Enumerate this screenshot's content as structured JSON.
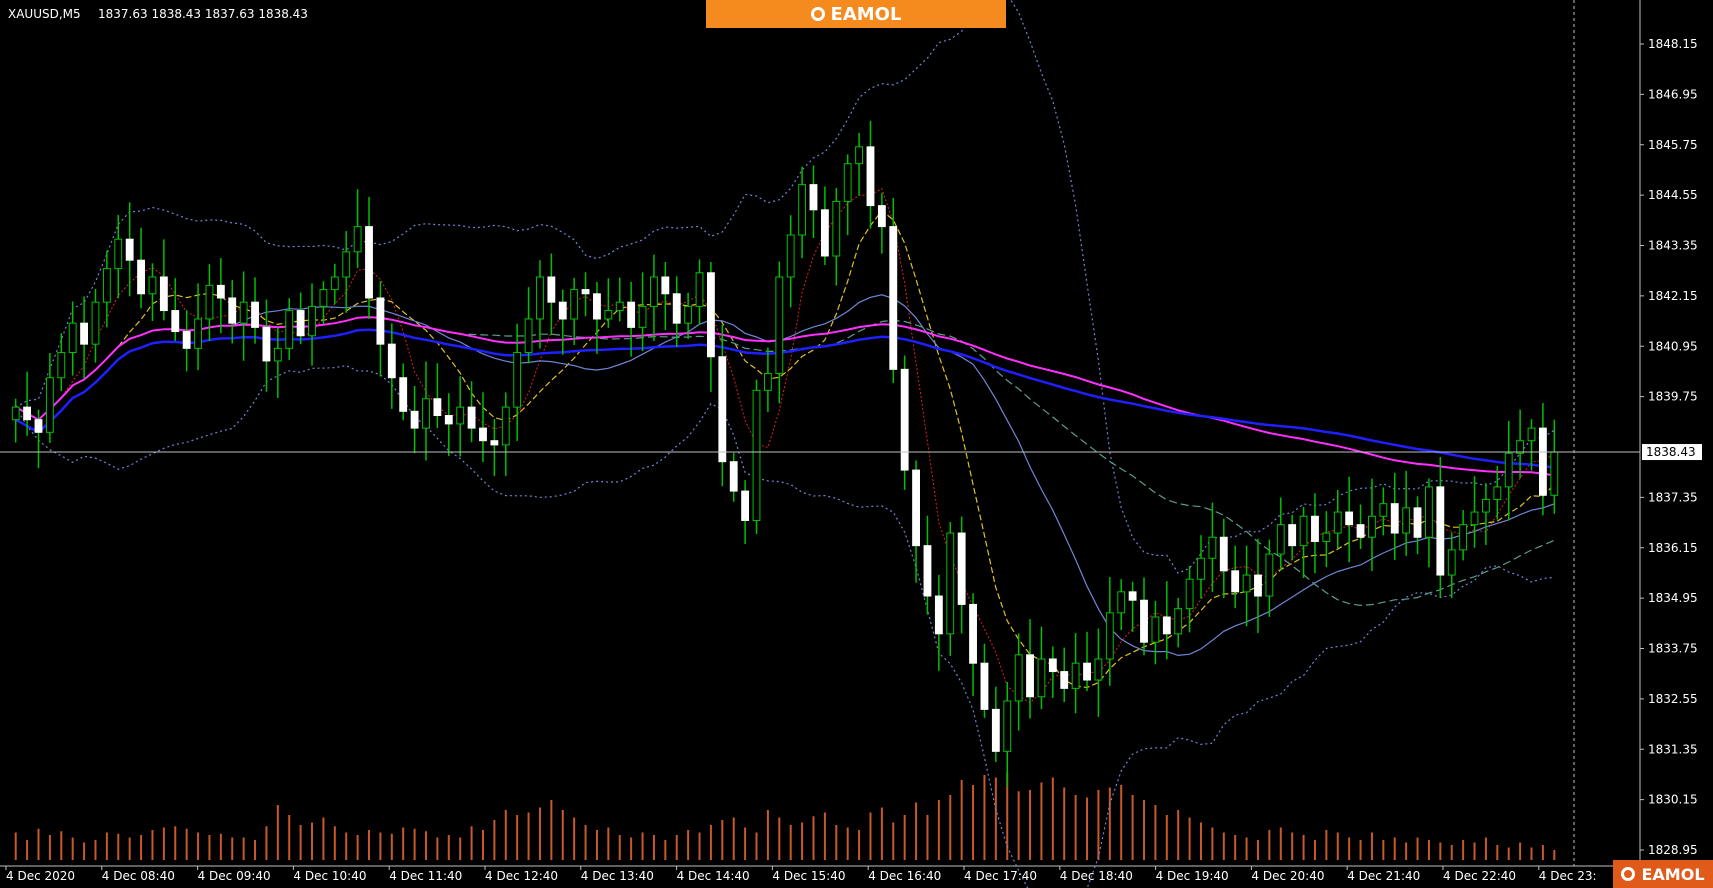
{
  "header": {
    "symbol": "XAUUSD,M5",
    "ohlc": "1837.63 1838.43 1837.63 1838.43"
  },
  "brand": {
    "text": "EAMOL"
  },
  "price_axis": {
    "ticks": [
      "1848.15",
      "1846.95",
      "1845.75",
      "1844.55",
      "1843.35",
      "1842.15",
      "1840.95",
      "1839.75",
      "1837.35",
      "1836.15",
      "1834.95",
      "1833.75",
      "1832.55",
      "1831.35",
      "1830.15",
      "1828.95"
    ],
    "current_price": "1838.43"
  },
  "time_axis": {
    "ticks": [
      "4 Dec 2020",
      "4 Dec 08:40",
      "4 Dec 09:40",
      "4 Dec 10:40",
      "4 Dec 11:40",
      "4 Dec 12:40",
      "4 Dec 13:40",
      "4 Dec 14:40",
      "4 Dec 15:40",
      "4 Dec 16:40",
      "4 Dec 17:40",
      "4 Dec 18:40",
      "4 Dec 19:40",
      "4 Dec 20:40",
      "4 Dec 21:40",
      "4 Dec 22:40",
      "4 Dec 23:"
    ]
  },
  "colors": {
    "background": "#000000",
    "bull": "#00c000",
    "bear": "#ffffff",
    "ma_magenta": "#ff30ff",
    "ma_blue": "#1f1fff",
    "bollinger": "#6f86d6",
    "volume": "#c85a2a",
    "price_line": "#c0c0c0",
    "brand": "#f58a1f"
  },
  "chart_data": {
    "type": "candlestick",
    "symbol": "XAUUSD",
    "timeframe": "M5",
    "ylim": [
      1828.4,
      1848.9
    ],
    "current_price": 1838.43,
    "close": [
      1839.5,
      1839.2,
      1838.9,
      1840.2,
      1840.8,
      1841.5,
      1841.0,
      1842.0,
      1842.8,
      1843.5,
      1843.0,
      1842.2,
      1842.6,
      1841.8,
      1841.3,
      1840.9,
      1841.6,
      1842.4,
      1842.1,
      1841.5,
      1842.0,
      1841.4,
      1840.6,
      1840.9,
      1841.8,
      1841.2,
      1841.9,
      1842.3,
      1842.6,
      1843.2,
      1843.8,
      1842.1,
      1841.0,
      1840.2,
      1839.4,
      1839.0,
      1839.7,
      1839.3,
      1839.1,
      1839.5,
      1839.0,
      1838.7,
      1838.6,
      1839.5,
      1840.8,
      1841.6,
      1842.6,
      1842.0,
      1841.6,
      1842.3,
      1842.2,
      1841.6,
      1841.8,
      1842.0,
      1841.4,
      1841.9,
      1842.6,
      1842.2,
      1841.5,
      1841.9,
      1842.7,
      1840.7,
      1838.2,
      1837.5,
      1836.8,
      1839.9,
      1840.3,
      1842.6,
      1843.6,
      1844.8,
      1844.2,
      1843.1,
      1844.4,
      1845.3,
      1845.7,
      1844.3,
      1843.8,
      1840.4,
      1838.0,
      1836.2,
      1835.0,
      1834.1,
      1836.5,
      1834.8,
      1833.4,
      1832.3,
      1831.3,
      1832.5,
      1833.6,
      1832.6,
      1833.5,
      1833.2,
      1832.8,
      1833.4,
      1833.0,
      1833.5,
      1834.6,
      1835.1,
      1834.9,
      1833.9,
      1834.5,
      1834.1,
      1834.7,
      1835.4,
      1835.9,
      1836.4,
      1835.6,
      1835.1,
      1835.5,
      1835.0,
      1836.0,
      1836.7,
      1836.2,
      1836.9,
      1836.3,
      1836.5,
      1837.0,
      1836.7,
      1836.4,
      1836.9,
      1837.2,
      1836.5,
      1837.1,
      1836.4,
      1837.6,
      1835.5,
      1836.1,
      1836.7,
      1837.0,
      1837.3,
      1837.6,
      1838.4,
      1838.7,
      1839.0,
      1837.4,
      1838.43
    ],
    "volume": [
      22,
      16,
      25,
      20,
      23,
      18,
      14,
      16,
      22,
      21,
      18,
      20,
      24,
      26,
      27,
      25,
      22,
      20,
      21,
      18,
      18,
      16,
      27,
      44,
      36,
      28,
      30,
      34,
      27,
      22,
      20,
      24,
      22,
      21,
      26,
      25,
      23,
      18,
      20,
      18,
      27,
      24,
      32,
      40,
      36,
      38,
      42,
      48,
      40,
      34,
      28,
      24,
      26,
      20,
      18,
      22,
      20,
      16,
      20,
      24,
      22,
      28,
      32,
      34,
      26,
      22,
      40,
      34,
      28,
      30,
      35,
      38,
      28,
      26,
      24,
      38,
      42,
      30,
      36,
      46,
      36,
      48,
      52,
      64,
      60,
      68,
      66,
      70,
      55,
      56,
      62,
      66,
      58,
      52,
      50,
      56,
      58,
      60,
      52,
      48,
      44,
      36,
      40,
      34,
      30,
      26,
      22,
      20,
      18,
      16,
      24,
      26,
      22,
      20,
      16,
      24,
      22,
      18,
      16,
      22,
      16,
      18,
      14,
      18,
      16,
      14,
      12,
      16,
      14,
      18,
      12,
      10,
      14,
      10,
      12,
      8
    ]
  }
}
